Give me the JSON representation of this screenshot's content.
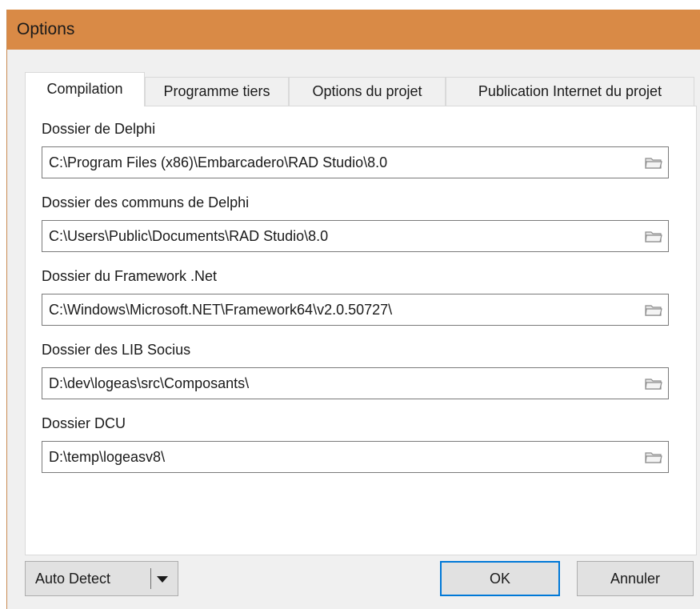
{
  "window": {
    "title": "Options"
  },
  "tabs": [
    {
      "label": "Compilation",
      "active": true
    },
    {
      "label": "Programme tiers",
      "active": false
    },
    {
      "label": "Options du projet",
      "active": false
    },
    {
      "label": "Publication Internet du projet",
      "active": false
    }
  ],
  "fields": [
    {
      "label": "Dossier de Delphi",
      "value": "C:\\Program Files (x86)\\Embarcadero\\RAD Studio\\8.0",
      "icon": "folder-icon"
    },
    {
      "label": "Dossier des communs de Delphi",
      "value": "C:\\Users\\Public\\Documents\\RAD Studio\\8.0",
      "icon": "folder-icon"
    },
    {
      "label": "Dossier du Framework .Net",
      "value": "C:\\Windows\\Microsoft.NET\\Framework64\\v2.0.50727\\",
      "icon": "folder-icon"
    },
    {
      "label": "Dossier des LIB Socius",
      "value": "D:\\dev\\logeas\\src\\Composants\\",
      "icon": "folder-icon"
    },
    {
      "label": "Dossier DCU",
      "value": "D:\\temp\\logeasv8\\",
      "icon": "folder-icon"
    }
  ],
  "buttons": {
    "auto_detect": "Auto Detect",
    "ok": "OK",
    "cancel": "Annuler"
  },
  "colors": {
    "titlebar": "#d98a46",
    "default_button_border": "#0078d7"
  }
}
